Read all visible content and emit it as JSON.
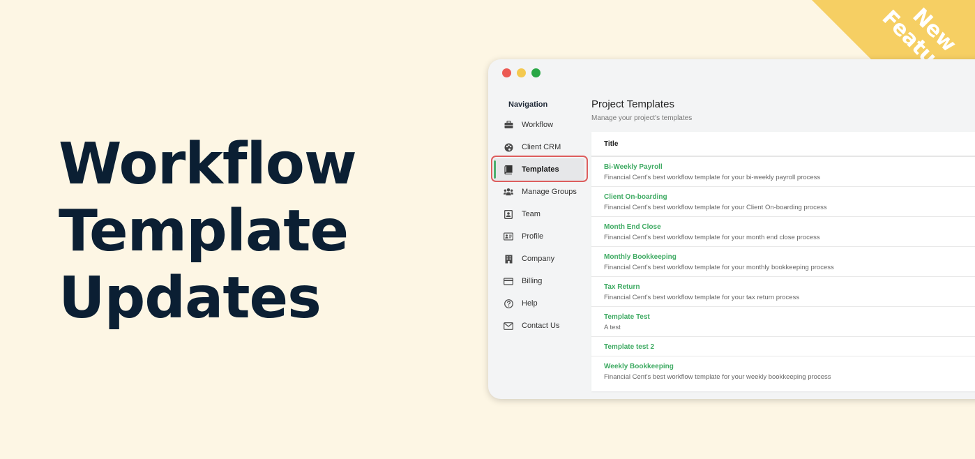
{
  "headline": [
    "Workflow",
    "Template",
    "Updates"
  ],
  "ribbon": [
    "New",
    "Feature"
  ],
  "colors": {
    "background": "#fdf6e4",
    "headline": "#0b1f33",
    "ribbon": "#f6cf63",
    "accent_green": "#3eaa62",
    "highlight_outline": "#dd5e5e"
  },
  "nav": {
    "title": "Navigation",
    "items": [
      {
        "label": "Workflow",
        "icon": "briefcase-icon"
      },
      {
        "label": "Client CRM",
        "icon": "palette-icon"
      },
      {
        "label": "Templates",
        "icon": "book-icon",
        "active": true
      },
      {
        "label": "Manage Groups",
        "icon": "users-icon"
      },
      {
        "label": "Team",
        "icon": "contact-card-icon"
      },
      {
        "label": "Profile",
        "icon": "id-card-icon"
      },
      {
        "label": "Company",
        "icon": "building-icon"
      },
      {
        "label": "Billing",
        "icon": "credit-card-icon"
      },
      {
        "label": "Help",
        "icon": "question-circle-icon"
      },
      {
        "label": "Contact Us",
        "icon": "envelope-icon"
      }
    ]
  },
  "main": {
    "title": "Project Templates",
    "subtitle": "Manage your project's templates",
    "column_header": "Title",
    "rows": [
      {
        "title": "Bi-Weekly Payroll",
        "desc": "Financial Cent's best workflow template for your bi-weekly payroll process"
      },
      {
        "title": "Client On-boarding",
        "desc": "Financial Cent's best workflow template for your Client On-boarding process"
      },
      {
        "title": "Month End Close",
        "desc": "Financial Cent's best workflow template for your month end close process"
      },
      {
        "title": "Monthly Bookkeeping",
        "desc": "Financial Cent's best workflow template for your monthly bookkeeping process"
      },
      {
        "title": "Tax Return",
        "desc": "Financial Cent's best workflow template for your tax return process"
      },
      {
        "title": "Template Test",
        "desc": "A test"
      },
      {
        "title": "Template test 2",
        "desc": ""
      },
      {
        "title": "Weekly Bookkeeping",
        "desc": "Financial Cent's best workflow template for your weekly bookkeeping process"
      }
    ]
  }
}
